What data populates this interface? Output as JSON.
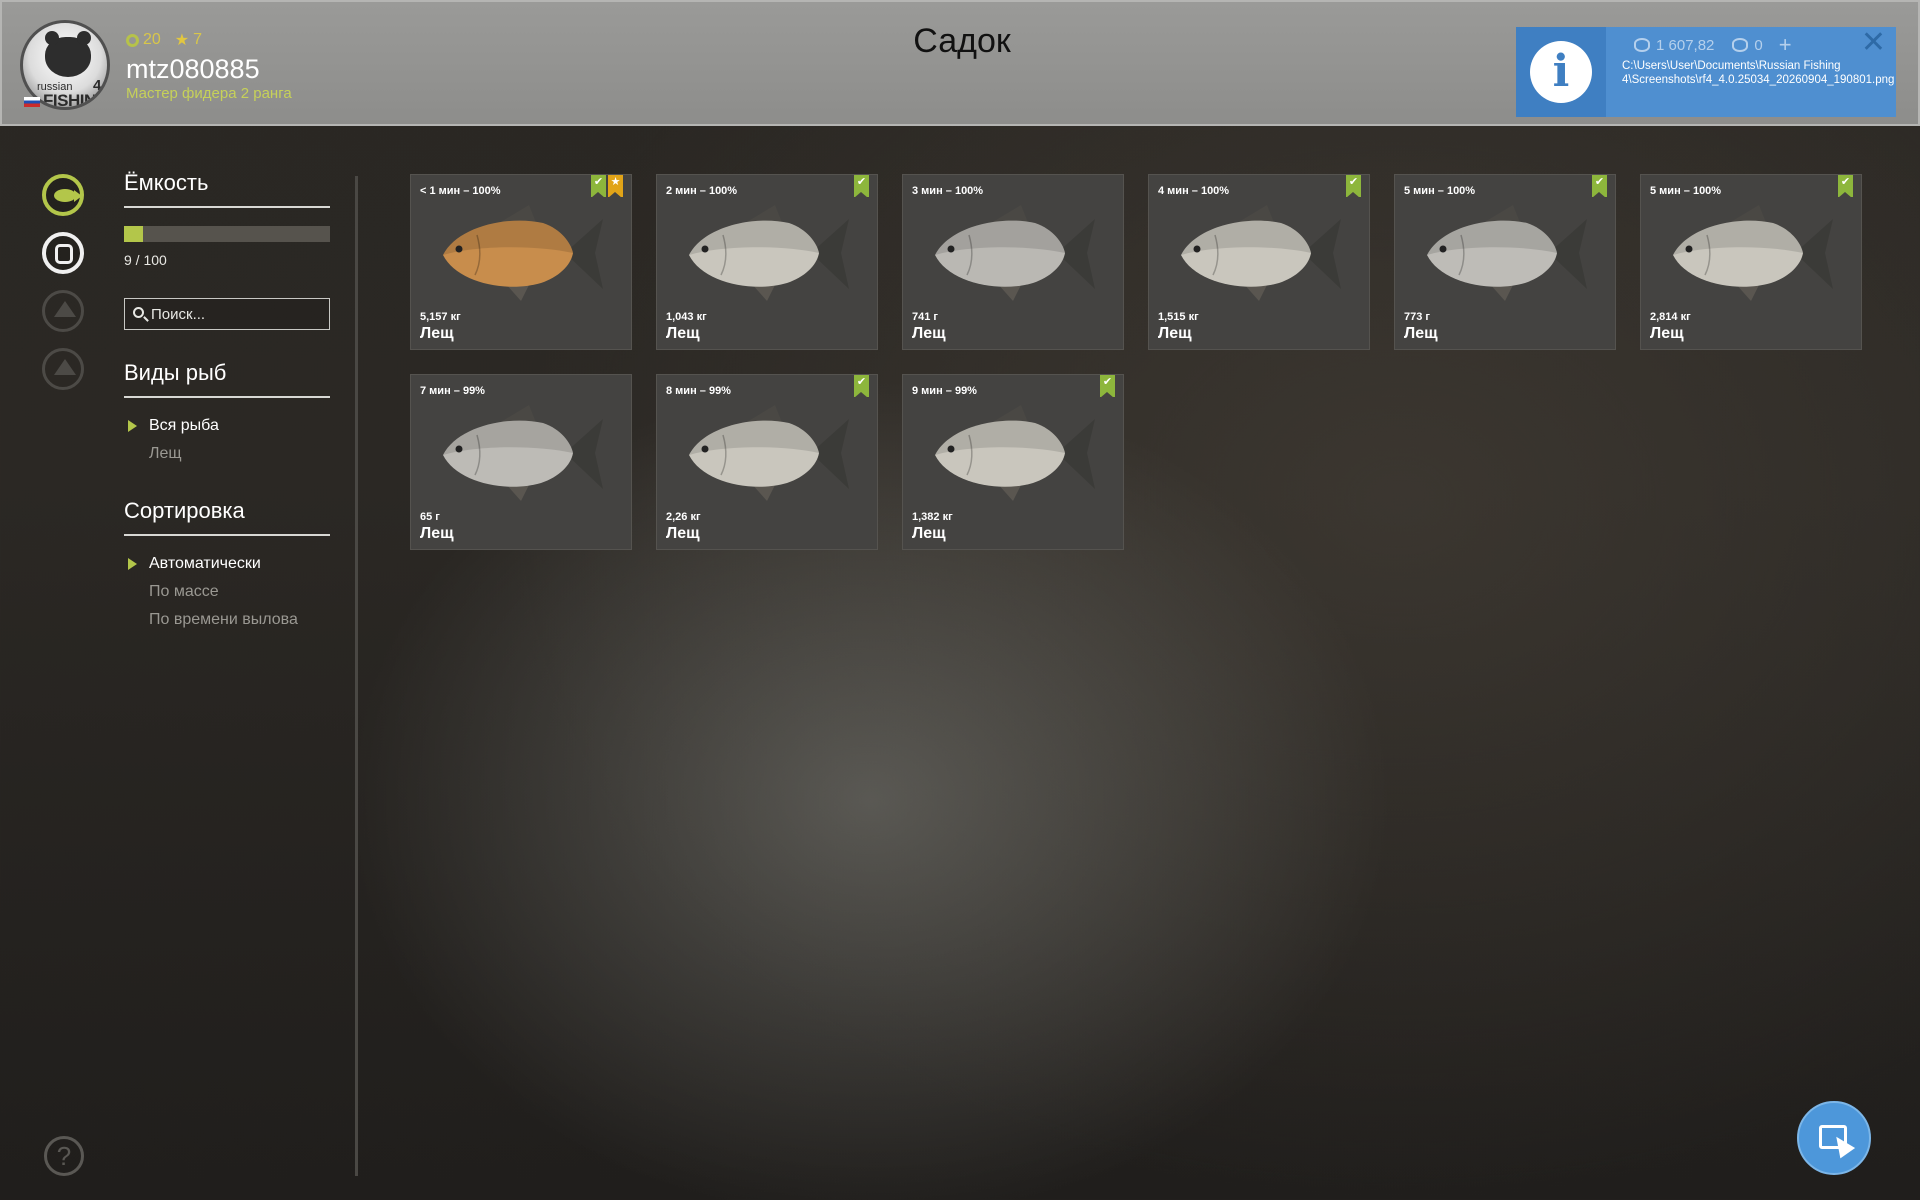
{
  "header": {
    "title": "Садок",
    "player": {
      "level": "20",
      "stars": "7",
      "username": "mtz080885",
      "rank": "Мастер фидера 2 ранга"
    },
    "notification": {
      "silver": "1 607,82",
      "gold": "0",
      "path": "C:\\Users\\User\\Documents\\Russian Fishing 4\\Screenshots\\rf4_4.0.25034_20260904_190801.png"
    }
  },
  "nav": {
    "icons": [
      "fish-icon",
      "keepnet-icon",
      "locked-icon",
      "home-icon"
    ]
  },
  "panel": {
    "capacity": {
      "title": "Ёмкость",
      "used": 9,
      "max": 100,
      "label": "9 / 100"
    },
    "search": {
      "placeholder": "Поиск..."
    },
    "species": {
      "title": "Виды рыб",
      "options": [
        "Вся рыба",
        "Лещ"
      ],
      "selected": "Вся рыба"
    },
    "sort": {
      "title": "Сортировка",
      "options": [
        "Автоматически",
        "По массе",
        "По времени вылова"
      ],
      "selected": "Автоматически"
    }
  },
  "fish": [
    {
      "time": "< 1 мин – 100%",
      "weight": "5,157 кг",
      "name": "Лещ",
      "check": true,
      "star": true,
      "color": "#c88d4c"
    },
    {
      "time": "2 мин – 100%",
      "weight": "1,043 кг",
      "name": "Лещ",
      "check": true,
      "star": false,
      "color": "#c9c6bd"
    },
    {
      "time": "3 мин – 100%",
      "weight": "741 г",
      "name": "Лещ",
      "check": false,
      "star": false,
      "color": "#bab8b3"
    },
    {
      "time": "4 мин – 100%",
      "weight": "1,515 кг",
      "name": "Лещ",
      "check": true,
      "star": false,
      "color": "#c9c6bd"
    },
    {
      "time": "5 мин – 100%",
      "weight": "773 г",
      "name": "Лещ",
      "check": true,
      "star": false,
      "color": "#bebcb7"
    },
    {
      "time": "5 мин – 100%",
      "weight": "2,814 кг",
      "name": "Лещ",
      "check": true,
      "star": false,
      "color": "#c9c6bd"
    },
    {
      "time": "7 мин – 99%",
      "weight": "65 г",
      "name": "Лещ",
      "check": false,
      "star": false,
      "color": "#bdbbb6"
    },
    {
      "time": "8 мин – 99%",
      "weight": "2,26 кг",
      "name": "Лещ",
      "check": true,
      "star": false,
      "color": "#c9c6bd"
    },
    {
      "time": "9 мин – 99%",
      "weight": "1,382 кг",
      "name": "Лещ",
      "check": true,
      "star": false,
      "color": "#c9c6bd"
    }
  ]
}
